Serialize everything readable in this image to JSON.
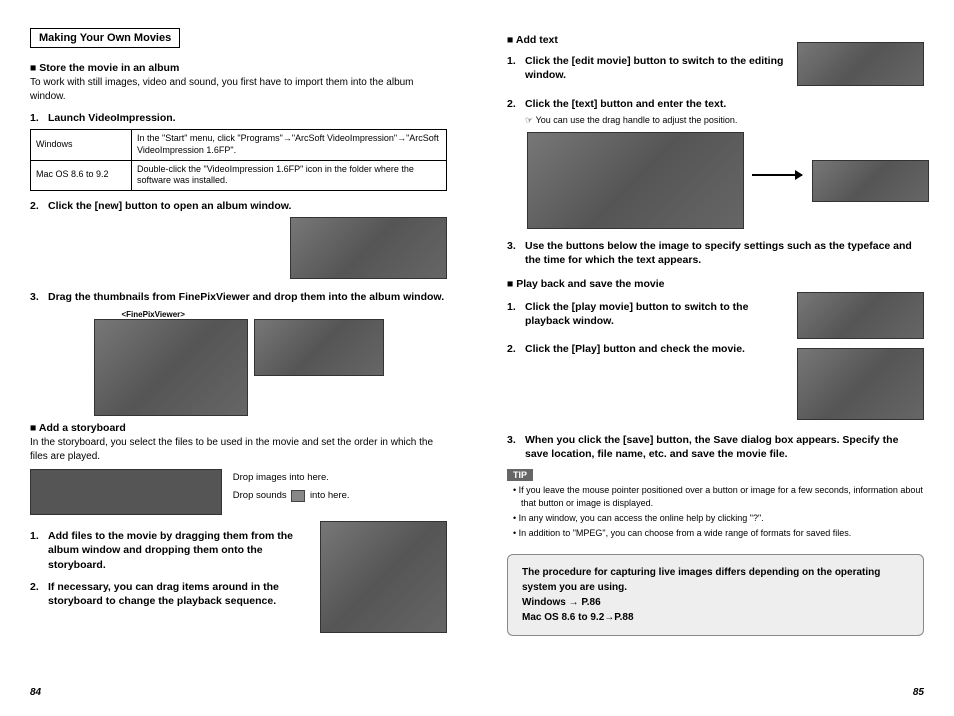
{
  "left": {
    "pageNum": "84",
    "heading": "Making Your Own Movies",
    "sec1": {
      "title": "■ Store the movie in an album",
      "body": "To work with still images, video and sound, you first have to import them into the album window."
    },
    "step1": "Launch VideoImpression.",
    "table": {
      "r1c1": "Windows",
      "r1c2": "In the \"Start\" menu, click \"Programs\"→\"ArcSoft VideoImpression\"→\"ArcSoft VideoImpression 1.6FP\".",
      "r2c1": "Mac OS 8.6 to 9.2",
      "r2c2": "Double-click the \"VideoImpression 1.6FP\" icon in the folder where the software was installed."
    },
    "step2": "Click the [new] button to open an album window.",
    "step3": "Drag the thumbnails from FinePixViewer and drop them into the album window.",
    "fpvLabel": "<FinePixViewer>",
    "sec2": {
      "title": "■ Add a storyboard",
      "body": "In the storyboard, you select the files to be used in the movie and set the order in which the files are played."
    },
    "dropImages": "Drop images into here.",
    "dropSounds1": "Drop sounds",
    "dropSounds2": "into here.",
    "sb_step1": "Add files to the movie by dragging them from the album window and dropping them onto the storyboard.",
    "sb_step2": "If necessary, you can drag items around in the storyboard to change the playback sequence."
  },
  "right": {
    "pageNum": "85",
    "addtext": {
      "title": "■ Add text",
      "step1": "Click the [edit movie] button to switch to the editing window.",
      "step2": "Click the [text] button and enter the text.",
      "note": "You can use the drag handle to adjust the position.",
      "step3": "Use the buttons below the image to specify settings such as the typeface and the time for which the text appears."
    },
    "playback": {
      "title": "■ Play back and save the movie",
      "step1": "Click the [play movie] button to switch to the playback window.",
      "step2": "Click the [Play] button and check the movie.",
      "step3": "When you click the [save] button, the Save dialog box appears. Specify the save location, file name, etc. and save the movie file."
    },
    "tipLabel": "TIP",
    "tips": [
      "If you leave the mouse pointer positioned over a button or image for a few seconds, information about that button or image is displayed.",
      "In any window, you can access the online help by clicking \"?\".",
      "In addition to \"MPEG\", you can choose from a wide range of formats for saved files."
    ],
    "infobox": {
      "l1": "The procedure for capturing live images differs depending on the operating system you are using.",
      "l2": "Windows → P.86",
      "l3": "Mac OS 8.6 to 9.2→P.88"
    }
  }
}
